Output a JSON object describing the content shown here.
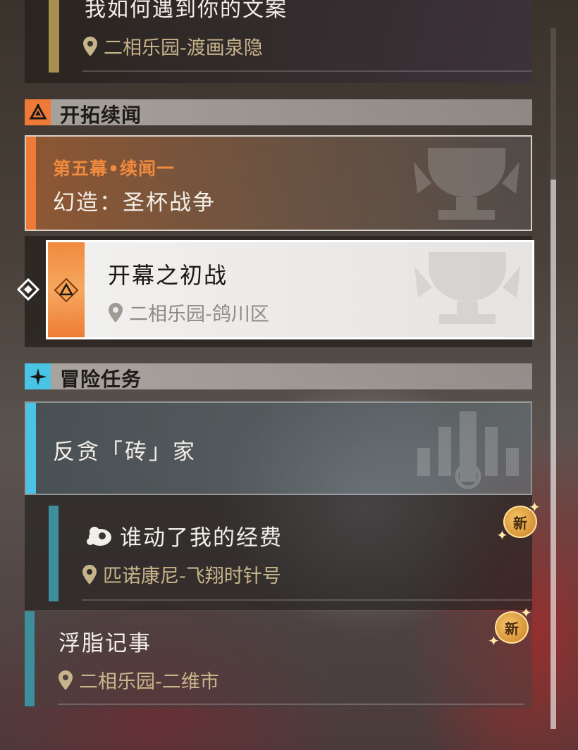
{
  "top_mission": {
    "title": "我如何遇到你的文案",
    "location": "二相乐园-渡画泉隐"
  },
  "section_trailblaze": {
    "label": "开拓续闻",
    "icon": "trailblaze-triangle-icon",
    "accent": "#ef7a37"
  },
  "trailblaze_group": {
    "chapter": "第五幕•续闻一",
    "name": "幻造：圣杯战争"
  },
  "selected_mission": {
    "title": "开幕之初战",
    "location": "二相乐园-鸽川区"
  },
  "section_adventure": {
    "label": "冒险任务",
    "icon": "adventure-sparkle-icon",
    "accent": "#49c4e5"
  },
  "adventure_group": {
    "name": "反贪「砖」家"
  },
  "sub_mission": {
    "title": "谁动了我的经费",
    "location": "匹诺康尼-飞翔时针号",
    "badge": "新"
  },
  "third_mission": {
    "title": "浮脂记事",
    "location": "二相乐园-二维市",
    "badge": "新"
  }
}
